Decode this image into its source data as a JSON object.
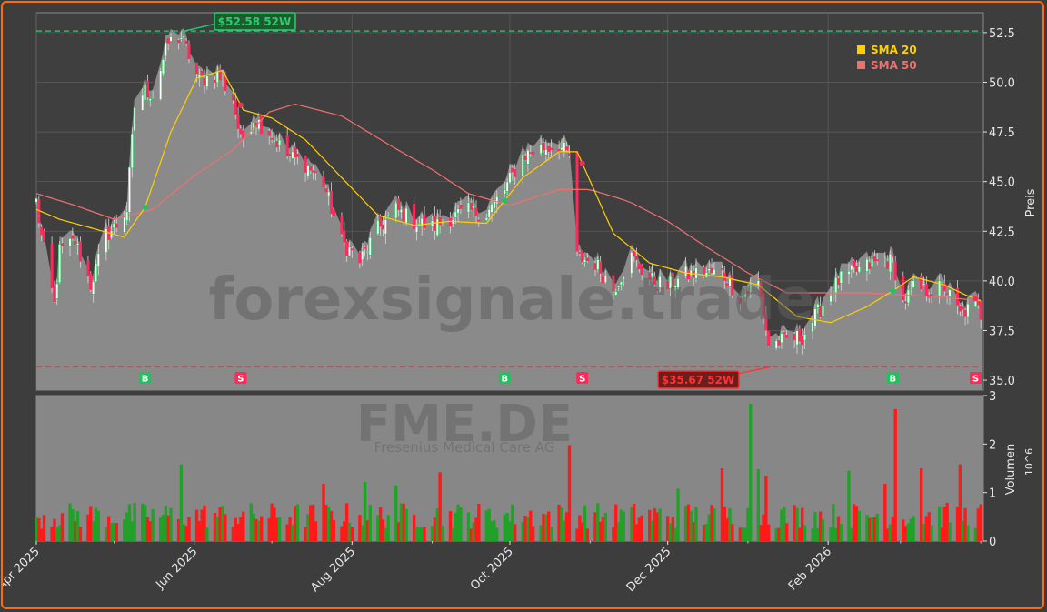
{
  "chart_data": [
    {
      "type": "candlestick",
      "watermark": "forexsignale.trade",
      "ylabel": "Preis",
      "ylim": [
        34.5,
        53.5
      ],
      "yticks": [
        "35.0",
        "37.5",
        "40.0",
        "42.5",
        "45.0",
        "47.5",
        "50.0",
        "52.5"
      ],
      "ytick_values": [
        35.0,
        37.5,
        40.0,
        42.5,
        45.0,
        47.5,
        50.0,
        52.5
      ],
      "legend_position": "top-right",
      "legend": [
        {
          "label": "SMA 20",
          "color": "#ffd000"
        },
        {
          "label": "SMA 50",
          "color": "#f07070"
        }
      ],
      "high_52w": {
        "value": 52.58,
        "label": "$52.58 52W",
        "color": "#2ecc71"
      },
      "low_52w": {
        "value": 35.67,
        "label": "$35.67 52W",
        "color": "#ff3333"
      },
      "signals": [
        {
          "type": "B",
          "date": "2025-05-13"
        },
        {
          "type": "S",
          "date": "2025-06-19"
        },
        {
          "type": "B",
          "date": "2025-09-29"
        },
        {
          "type": "S",
          "date": "2025-10-29"
        },
        {
          "type": "B",
          "date": "2026-02-26"
        },
        {
          "type": "S",
          "date": "2026-03-30"
        }
      ],
      "price_close_keypoints": [
        [
          "2025-04-01",
          44.0
        ],
        [
          "2025-04-03",
          42.2
        ],
        [
          "2025-04-08",
          38.8
        ],
        [
          "2025-04-10",
          41.5
        ],
        [
          "2025-04-16",
          42.0
        ],
        [
          "2025-04-22",
          39.8
        ],
        [
          "2025-04-28",
          42.3
        ],
        [
          "2025-05-02",
          42.8
        ],
        [
          "2025-05-06",
          43.6
        ],
        [
          "2025-05-09",
          48.8
        ],
        [
          "2025-05-13",
          49.6
        ],
        [
          "2025-05-16",
          49.4
        ],
        [
          "2025-05-22",
          52.0
        ],
        [
          "2025-05-27",
          52.3
        ],
        [
          "2025-06-03",
          50.1
        ],
        [
          "2025-06-10",
          50.4
        ],
        [
          "2025-06-16",
          49.2
        ],
        [
          "2025-06-19",
          47.0
        ],
        [
          "2025-06-24",
          48.2
        ],
        [
          "2025-06-30",
          47.5
        ],
        [
          "2025-07-07",
          46.3
        ],
        [
          "2025-07-14",
          45.9
        ],
        [
          "2025-07-21",
          44.9
        ],
        [
          "2025-07-28",
          42.0
        ],
        [
          "2025-08-04",
          41.0
        ],
        [
          "2025-08-11",
          42.6
        ],
        [
          "2025-08-18",
          43.6
        ],
        [
          "2025-08-25",
          43.0
        ],
        [
          "2025-09-01",
          42.7
        ],
        [
          "2025-09-08",
          43.2
        ],
        [
          "2025-09-15",
          43.5
        ],
        [
          "2025-09-22",
          43.4
        ],
        [
          "2025-09-29",
          44.6
        ],
        [
          "2025-10-06",
          46.3
        ],
        [
          "2025-10-13",
          46.7
        ],
        [
          "2025-10-20",
          46.8
        ],
        [
          "2025-10-24",
          46.3
        ],
        [
          "2025-10-27",
          41.2
        ],
        [
          "2025-11-03",
          40.9
        ],
        [
          "2025-11-10",
          39.6
        ],
        [
          "2025-11-17",
          41.2
        ],
        [
          "2025-11-24",
          40.1
        ],
        [
          "2025-12-01",
          39.7
        ],
        [
          "2025-12-08",
          40.3
        ],
        [
          "2025-12-15",
          40.4
        ],
        [
          "2025-12-22",
          40.4
        ],
        [
          "2025-12-29",
          39.2
        ],
        [
          "2026-01-05",
          39.9
        ],
        [
          "2026-01-09",
          36.8
        ],
        [
          "2026-01-15",
          37.0
        ],
        [
          "2026-01-22",
          37.2
        ],
        [
          "2026-01-29",
          38.6
        ],
        [
          "2026-02-05",
          40.0
        ],
        [
          "2026-02-12",
          40.5
        ],
        [
          "2026-02-19",
          40.9
        ],
        [
          "2026-02-26",
          41.0
        ],
        [
          "2026-03-02",
          38.9
        ],
        [
          "2026-03-06",
          39.6
        ],
        [
          "2026-03-12",
          39.5
        ],
        [
          "2026-03-18",
          39.7
        ],
        [
          "2026-03-24",
          38.3
        ],
        [
          "2026-03-30",
          38.8
        ],
        [
          "2026-04-01",
          38.3
        ]
      ],
      "sma20_keypoints": [
        [
          "2025-04-01",
          43.6
        ],
        [
          "2025-04-10",
          43.1
        ],
        [
          "2025-04-24",
          42.6
        ],
        [
          "2025-05-05",
          42.2
        ],
        [
          "2025-05-13",
          43.7
        ],
        [
          "2025-05-23",
          47.5
        ],
        [
          "2025-06-02",
          50.2
        ],
        [
          "2025-06-12",
          50.6
        ],
        [
          "2025-06-20",
          48.6
        ],
        [
          "2025-07-01",
          48.2
        ],
        [
          "2025-07-14",
          47.1
        ],
        [
          "2025-07-28",
          45.2
        ],
        [
          "2025-08-11",
          43.3
        ],
        [
          "2025-08-25",
          42.8
        ],
        [
          "2025-09-08",
          43.0
        ],
        [
          "2025-09-22",
          42.9
        ],
        [
          "2025-10-06",
          45.2
        ],
        [
          "2025-10-20",
          46.5
        ],
        [
          "2025-10-27",
          46.5
        ],
        [
          "2025-11-10",
          42.4
        ],
        [
          "2025-11-24",
          40.9
        ],
        [
          "2025-12-08",
          40.4
        ],
        [
          "2025-12-22",
          40.2
        ],
        [
          "2026-01-05",
          39.8
        ],
        [
          "2026-01-20",
          38.2
        ],
        [
          "2026-02-02",
          37.9
        ],
        [
          "2026-02-16",
          38.7
        ],
        [
          "2026-02-26",
          39.5
        ],
        [
          "2026-03-06",
          40.2
        ],
        [
          "2026-03-18",
          39.8
        ],
        [
          "2026-03-26",
          39.3
        ],
        [
          "2026-04-01",
          39.0
        ]
      ],
      "sma50_keypoints": [
        [
          "2025-04-01",
          44.4
        ],
        [
          "2025-04-16",
          43.8
        ],
        [
          "2025-05-01",
          43.1
        ],
        [
          "2025-05-16",
          43.6
        ],
        [
          "2025-06-01",
          45.3
        ],
        [
          "2025-06-16",
          46.6
        ],
        [
          "2025-06-30",
          48.5
        ],
        [
          "2025-07-10",
          48.9
        ],
        [
          "2025-07-28",
          48.3
        ],
        [
          "2025-08-16",
          46.8
        ],
        [
          "2025-09-01",
          45.6
        ],
        [
          "2025-09-15",
          44.4
        ],
        [
          "2025-10-01",
          43.8
        ],
        [
          "2025-10-20",
          44.6
        ],
        [
          "2025-11-01",
          44.6
        ],
        [
          "2025-11-16",
          44.0
        ],
        [
          "2025-12-01",
          43.0
        ],
        [
          "2025-12-16",
          41.7
        ],
        [
          "2026-01-01",
          40.4
        ],
        [
          "2026-01-16",
          39.4
        ],
        [
          "2026-02-01",
          39.4
        ],
        [
          "2026-02-16",
          39.4
        ],
        [
          "2026-03-01",
          39.3
        ],
        [
          "2026-03-16",
          39.2
        ],
        [
          "2026-04-01",
          39.0
        ]
      ]
    },
    {
      "type": "bar",
      "title": "FME.DE",
      "subtitle": "Fresenius Medical Care AG",
      "ylabel": "Volumen",
      "yscale_label": "10^6",
      "ylim": [
        0,
        3
      ],
      "yticks": [
        "0",
        "1",
        "2",
        "3"
      ],
      "ytick_values": [
        0,
        1,
        2,
        3
      ],
      "colors": {
        "up": "#22a12a",
        "down": "#ff1a1a"
      },
      "volume_spikes_millions": [
        [
          "2025-05-27",
          1.58
        ],
        [
          "2025-07-21",
          1.18
        ],
        [
          "2025-08-06",
          1.22
        ],
        [
          "2025-08-18",
          1.15
        ],
        [
          "2025-09-04",
          1.42
        ],
        [
          "2025-10-24",
          1.98
        ],
        [
          "2025-12-05",
          1.08
        ],
        [
          "2025-12-22",
          1.5
        ],
        [
          "2026-01-02",
          2.83
        ],
        [
          "2026-01-05",
          1.48
        ],
        [
          "2026-01-08",
          1.35
        ],
        [
          "2026-02-09",
          1.45
        ],
        [
          "2026-02-23",
          1.18
        ],
        [
          "2026-02-27",
          2.72
        ],
        [
          "2026-03-09",
          1.5
        ],
        [
          "2026-03-24",
          1.58
        ]
      ]
    },
    {
      "type": "time_axis",
      "xlabels": [
        "Apr 2025",
        "Jun 2025",
        "Aug 2025",
        "Oct 2025",
        "Dec 2025",
        "Feb 2026"
      ],
      "xtick_dates": [
        "2025-04-01",
        "2025-06-01",
        "2025-08-01",
        "2025-10-01",
        "2025-12-01",
        "2026-02-01"
      ],
      "xlim": [
        "2025-04-01",
        "2026-04-02"
      ]
    }
  ]
}
